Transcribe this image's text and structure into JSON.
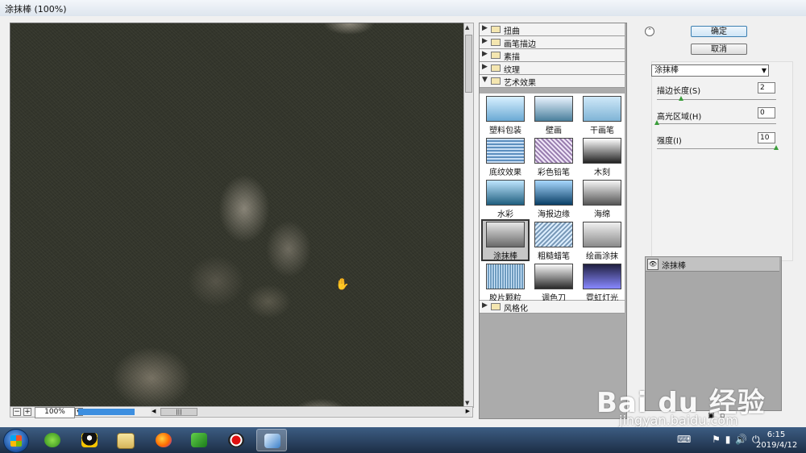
{
  "window": {
    "title": "涂抹棒 (100%)"
  },
  "zoom": {
    "value": "100%"
  },
  "gallery": {
    "categories_top": [
      "扭曲",
      "画笔描边",
      "素描",
      "纹理",
      "艺术效果"
    ],
    "category_bottom": "风格化",
    "filters": [
      "塑料包装",
      "壁画",
      "干画笔",
      "底纹效果",
      "彩色铅笔",
      "木刻",
      "水彩",
      "海报边缘",
      "海绵",
      "涂抹棒",
      "粗糙蜡笔",
      "绘画涂抹",
      "胶片颗粒",
      "调色刀",
      "霓虹灯光"
    ],
    "selected": "涂抹棒"
  },
  "buttons": {
    "ok": "确定",
    "cancel": "取消"
  },
  "filter_select": {
    "value": "涂抹棒"
  },
  "params": [
    {
      "label": "描边长度(S)",
      "value": "2"
    },
    {
      "label": "高光区域(H)",
      "value": "0"
    },
    {
      "label": "强度(I)",
      "value": "10"
    }
  ],
  "layers": {
    "current": "涂抹棒"
  },
  "taskbar": {
    "clock_time": "6:15",
    "clock_date": "2019/4/12"
  },
  "watermark": {
    "brand": "Bai du 经验",
    "url": "jingyan.baidu.com"
  },
  "colors": {
    "preview_bg": "#33352b",
    "accent": "#3d8fe0",
    "taskbar": "#2a4566",
    "slider_knob": "#3a9d3a"
  }
}
